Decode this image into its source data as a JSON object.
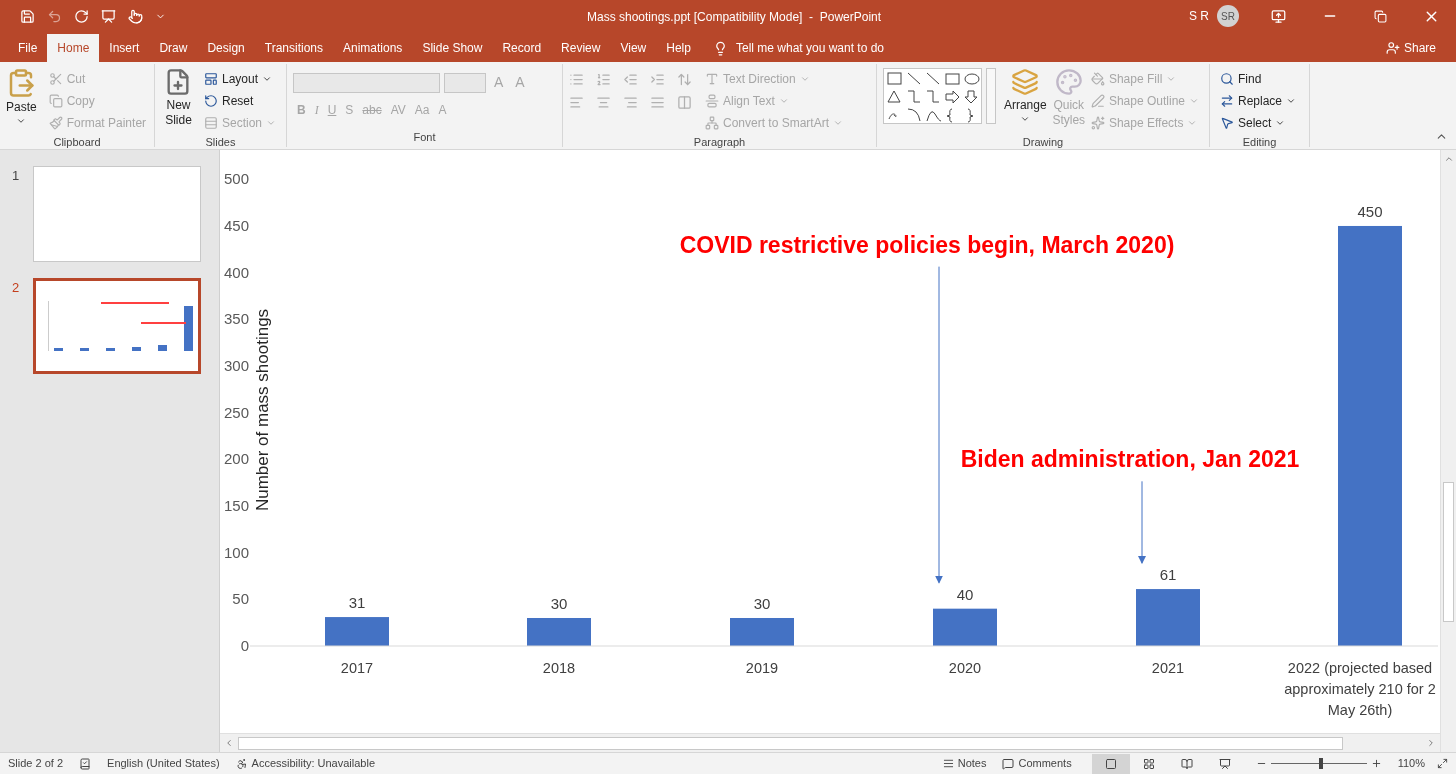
{
  "window": {
    "title": "Mass shootings.ppt [Compatibility Mode]  -  PowerPoint",
    "user_name": "S R",
    "user_initials": "SR"
  },
  "quick_access": {
    "undo_disabled": true
  },
  "tabs": [
    {
      "label": "File",
      "selected": false
    },
    {
      "label": "Home",
      "selected": true
    },
    {
      "label": "Insert",
      "selected": false
    },
    {
      "label": "Draw",
      "selected": false
    },
    {
      "label": "Design",
      "selected": false
    },
    {
      "label": "Transitions",
      "selected": false
    },
    {
      "label": "Animations",
      "selected": false
    },
    {
      "label": "Slide Show",
      "selected": false
    },
    {
      "label": "Record",
      "selected": false
    },
    {
      "label": "Review",
      "selected": false
    },
    {
      "label": "View",
      "selected": false
    },
    {
      "label": "Help",
      "selected": false
    }
  ],
  "tell_me": {
    "placeholder": "Tell me what you want to do"
  },
  "share": {
    "label": "Share"
  },
  "ribbon": {
    "clipboard": {
      "label": "Clipboard",
      "paste": {
        "label": "Paste",
        "disabled": false
      },
      "items": [
        {
          "label": "Cut",
          "disabled": true
        },
        {
          "label": "Copy",
          "disabled": true
        },
        {
          "label": "Format Painter",
          "disabled": true
        }
      ]
    },
    "slides": {
      "label": "Slides",
      "new_slide": {
        "label": "New Slide",
        "disabled": false
      },
      "items": [
        {
          "label": "Layout",
          "disabled": false
        },
        {
          "label": "Reset",
          "disabled": false
        },
        {
          "label": "Section",
          "disabled": true
        }
      ]
    },
    "font": {
      "label": "Font",
      "grow": [
        {
          "label": "A",
          "disabled": true
        },
        {
          "label": "A",
          "disabled": true
        }
      ],
      "format_buttons": [
        {
          "label": "B",
          "disabled": true
        },
        {
          "label": "I",
          "disabled": true
        },
        {
          "label": "U",
          "disabled": true
        },
        {
          "label": "S",
          "disabled": true
        },
        {
          "label": "abc",
          "disabled": true
        },
        {
          "label": "AV",
          "disabled": true
        },
        {
          "label": "Aa",
          "disabled": true
        },
        {
          "label": "A",
          "disabled": true
        }
      ]
    },
    "paragraph": {
      "label": "Paragraph",
      "items": [
        {
          "label": "Text Direction",
          "disabled": true
        },
        {
          "label": "Align Text",
          "disabled": true
        },
        {
          "label": "Convert to SmartArt",
          "disabled": true
        }
      ]
    },
    "drawing": {
      "label": "Drawing",
      "arrange": {
        "label": "Arrange",
        "disabled": false
      },
      "quick_styles": {
        "label": "Quick Styles",
        "disabled": true
      },
      "items": [
        {
          "label": "Shape Fill",
          "disabled": true
        },
        {
          "label": "Shape Outline",
          "disabled": true
        },
        {
          "label": "Shape Effects",
          "disabled": true
        }
      ]
    },
    "editing": {
      "label": "Editing",
      "items": [
        {
          "label": "Find",
          "disabled": false
        },
        {
          "label": "Replace",
          "disabled": false
        },
        {
          "label": "Select",
          "disabled": false
        }
      ]
    }
  },
  "slides": [
    {
      "number": "1",
      "selected": false
    },
    {
      "number": "2",
      "selected": true
    }
  ],
  "chart": {
    "chart_data": {
      "type": "bar",
      "ylabel": "Number of mass shootings",
      "categories": [
        "2017",
        "2018",
        "2019",
        "2020",
        "2021",
        "2022 (projected based\napproximately 210 for 2\nMay 26th)"
      ],
      "series": [
        {
          "color": "#4472c4",
          "values": [
            31,
            30,
            30,
            40,
            61,
            450
          ]
        }
      ],
      "ylim": [
        0,
        500
      ],
      "yticks": [
        0,
        50,
        100,
        150,
        200,
        250,
        300,
        350,
        400,
        450,
        500
      ],
      "data_labels": true,
      "annotations": [
        "COVID restrictive policies begin, March 2020)",
        "Biden administration, Jan 2021"
      ]
    }
  },
  "status_bar": {
    "slide": "Slide 2 of 2",
    "language": "English (United States)",
    "accessibility": "Accessibility: Unavailable",
    "notes": "Notes",
    "comments": "Comments",
    "views": [
      {
        "selected": true
      },
      {
        "selected": false
      },
      {
        "selected": false
      },
      {
        "selected": false
      }
    ],
    "zoom": {
      "level": 0.52
    },
    "zoom_reading": "110%"
  }
}
